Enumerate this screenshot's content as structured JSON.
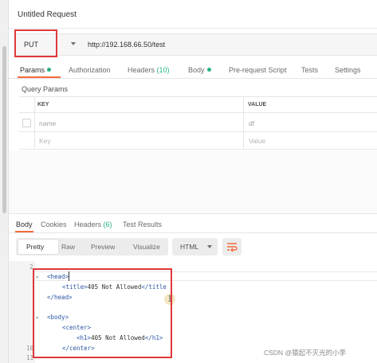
{
  "request": {
    "title": "Untitled Request",
    "method": "PUT",
    "url": "http://192.168.66.50/test"
  },
  "request_tabs": [
    {
      "label": "Params",
      "active": true,
      "dot": true
    },
    {
      "label": "Authorization"
    },
    {
      "label": "Headers",
      "count": "(10)"
    },
    {
      "label": "Body",
      "dot": true
    },
    {
      "label": "Pre-request Script"
    },
    {
      "label": "Tests"
    },
    {
      "label": "Settings"
    }
  ],
  "query_params": {
    "section_label": "Query Params",
    "columns": [
      "KEY",
      "VALUE"
    ],
    "rows": [
      {
        "key": "name",
        "value": "df"
      }
    ],
    "placeholder": {
      "key": "Key",
      "value": "Value"
    }
  },
  "response_tabs": [
    {
      "label": "Body",
      "active": true
    },
    {
      "label": "Cookies"
    },
    {
      "label": "Headers",
      "count": "(6)"
    },
    {
      "label": "Test Results"
    }
  ],
  "view_modes": [
    "Pretty",
    "Raw",
    "Preview",
    "Visualize"
  ],
  "active_view": "Pretty",
  "format": "HTML",
  "icons": {
    "wrap": "wrap-lines-icon",
    "format_caret": "chevron-down-icon"
  },
  "colors": {
    "accent": "#f26b3a",
    "highlight_box": "#e0383a",
    "dot": "#26b47f"
  },
  "code": {
    "line_numbers": [
      "2",
      "10",
      "11"
    ],
    "lines": [
      {
        "open": "<head>"
      },
      {
        "open": "<title>",
        "text": "405 Not Allowed",
        "close": "</title"
      },
      {
        "close": "</head>"
      },
      {
        "open": "<body>"
      },
      {
        "open": "<center>"
      },
      {
        "open": "<h1>",
        "text": "405 Not Allowed",
        "close": "</h1>"
      },
      {
        "close": "</center>"
      }
    ]
  },
  "watermark": "CSDN @猿起不灭光的小李"
}
